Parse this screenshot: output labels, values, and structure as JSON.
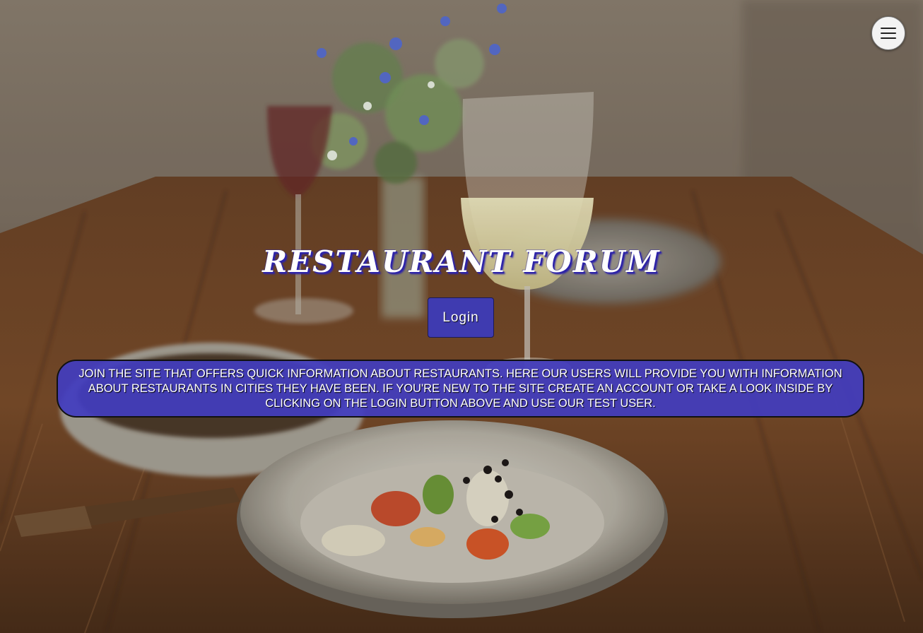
{
  "header": {
    "menu_icon": "hamburger-menu-icon"
  },
  "hero": {
    "title": "RESTAURANT FORUM",
    "login_label": "Login",
    "description": "JOIN THE SITE THAT OFFERS QUICK INFORMATION ABOUT RESTAURANTS. HERE OUR USERS WILL PROVIDE YOU WITH INFORMATION ABOUT RESTAURANTS IN CITIES THEY HAVE BEEN. IF YOU'RE NEW TO THE SITE CREATE AN ACCOUNT OR TAKE A LOOK INSIDE BY CLICKING ON THE LOGIN BUTTON ABOVE AND USE OUR TEST USER."
  },
  "colors": {
    "accent": "#3f3bb0",
    "title_shadow": "#2d23a8",
    "panel": "#423cbe"
  }
}
